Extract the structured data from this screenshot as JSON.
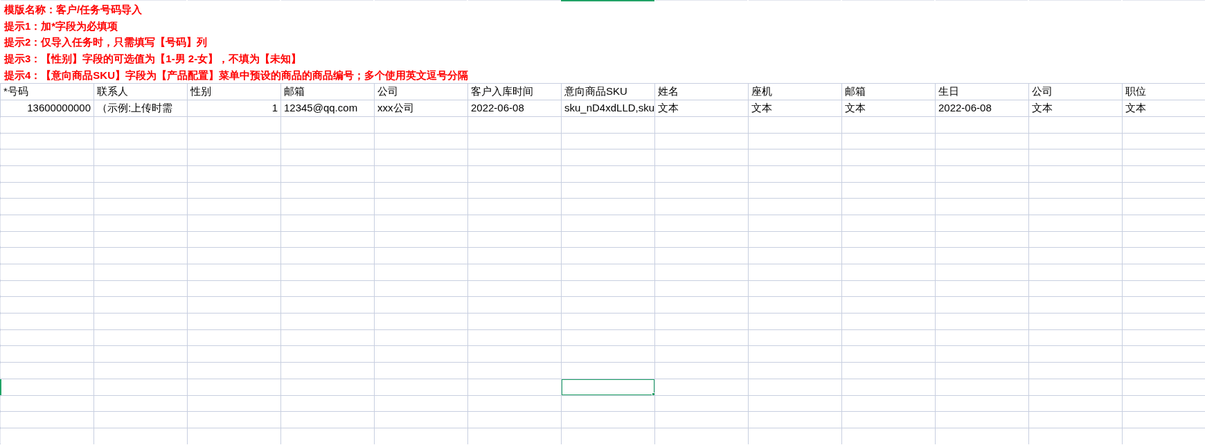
{
  "notes": [
    "模版名称：客户/任务号码导入",
    "提示1：加*字段为必填项",
    "提示2：仅导入任务时，只需填写【号码】列",
    "提示3：【性别】字段的可选值为【1-男 2-女】，不填为【未知】",
    "提示4：【意向商品SKU】字段为【产品配置】菜单中预设的商品的商品编号；多个使用英文逗号分隔"
  ],
  "columns": [
    {
      "label": "*号码",
      "selected": false
    },
    {
      "label": "联系人",
      "selected": false
    },
    {
      "label": "性别",
      "selected": false
    },
    {
      "label": "邮箱",
      "selected": false
    },
    {
      "label": "公司",
      "selected": false
    },
    {
      "label": "客户入库时间",
      "selected": false
    },
    {
      "label": "意向商品SKU",
      "selected": true
    },
    {
      "label": "姓名",
      "selected": false
    },
    {
      "label": "座机",
      "selected": false
    },
    {
      "label": "邮箱",
      "selected": false
    },
    {
      "label": "生日",
      "selected": false
    },
    {
      "label": "公司",
      "selected": false
    },
    {
      "label": "职位",
      "selected": false
    }
  ],
  "data_row": [
    {
      "text": "13600000000",
      "kind": "number"
    },
    {
      "text": "（示例:上传时需",
      "kind": "text"
    },
    {
      "text": "1",
      "kind": "number"
    },
    {
      "text": "12345@qq.com",
      "kind": "text"
    },
    {
      "text": "xxx公司",
      "kind": "text"
    },
    {
      "text": "2022-06-08",
      "kind": "text"
    },
    {
      "text": "sku_nD4xdLLD,sku",
      "kind": "text"
    },
    {
      "text": "文本",
      "kind": "text"
    },
    {
      "text": "文本",
      "kind": "text"
    },
    {
      "text": "文本",
      "kind": "text"
    },
    {
      "text": "2022-06-08",
      "kind": "text"
    },
    {
      "text": "文本",
      "kind": "text"
    },
    {
      "text": "文本",
      "kind": "text"
    }
  ],
  "empty_rows": [
    {
      "selected": false
    },
    {
      "selected": false
    },
    {
      "selected": false
    },
    {
      "selected": false
    },
    {
      "selected": false
    },
    {
      "selected": false
    },
    {
      "selected": false
    },
    {
      "selected": false
    },
    {
      "selected": false
    },
    {
      "selected": false
    },
    {
      "selected": false
    },
    {
      "selected": false
    },
    {
      "selected": false
    },
    {
      "selected": false
    },
    {
      "selected": false
    },
    {
      "selected": false
    },
    {
      "selected": true
    },
    {
      "selected": false
    },
    {
      "selected": false
    },
    {
      "selected": false
    }
  ]
}
